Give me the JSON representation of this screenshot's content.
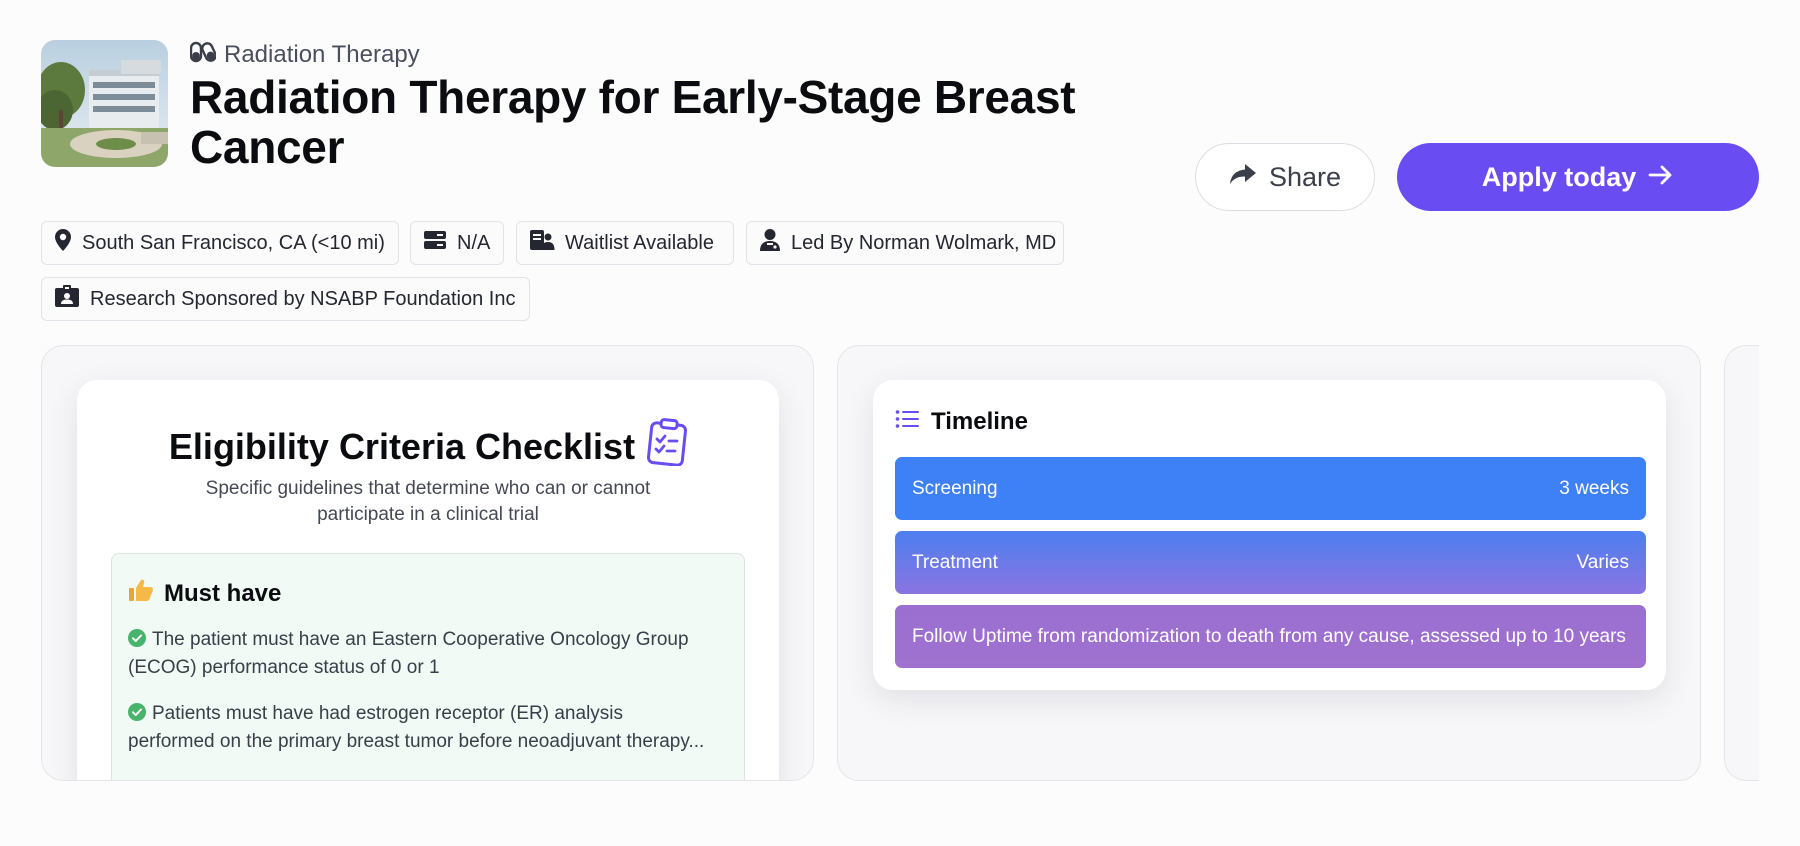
{
  "header": {
    "category": "Radiation Therapy",
    "category_icon": "pills-icon",
    "title": "Radiation Therapy for Early-Stage Breast Cancer",
    "thumbnail": "hospital-building-photo"
  },
  "actions": {
    "share_label": "Share",
    "share_icon": "share-arrow-icon",
    "apply_label": "Apply today",
    "apply_icon": "arrow-right-icon"
  },
  "chips": [
    {
      "icon": "location-pin-icon",
      "label": "South San Francisco, CA (<10 mi)"
    },
    {
      "icon": "server-icon",
      "label": "N/A"
    },
    {
      "icon": "patient-list-icon",
      "label": "Waitlist Available"
    },
    {
      "icon": "doctor-icon",
      "label": "Led By Norman Wolmark, MD"
    },
    {
      "icon": "id-badge-icon",
      "label": "Research Sponsored by NSABP Foundation Inc"
    }
  ],
  "eligibility": {
    "title": "Eligibility Criteria Checklist",
    "title_icon": "clipboard-check-icon",
    "subtitle_line1": "Specific guidelines that determine who can or cannot",
    "subtitle_line2": "participate in a clinical trial",
    "must_have": {
      "label": "Must have",
      "icon": "thumbs-up-icon",
      "items": [
        {
          "line1": "The patient must have an Eastern Cooperative Oncology Group",
          "line2": "(ECOG) performance status of 0 or 1"
        },
        {
          "line1": "Patients must have had estrogen receptor (ER) analysis",
          "line2": "performed on the primary breast tumor before neoadjuvant therapy..."
        }
      ]
    }
  },
  "timeline": {
    "title": "Timeline",
    "icon": "list-icon",
    "rows": [
      {
        "label": "Screening",
        "value": "3 weeks"
      },
      {
        "label": "Treatment",
        "value": "Varies"
      },
      {
        "label": "Follow Uptime from randomization to death from any cause, assessed up to 10 years",
        "value": ""
      }
    ]
  },
  "colors": {
    "accent": "#6a4cf3",
    "timeline_blue": "#3e80f6",
    "timeline_purple": "#9a6fd0",
    "check_green": "#48b36a"
  }
}
